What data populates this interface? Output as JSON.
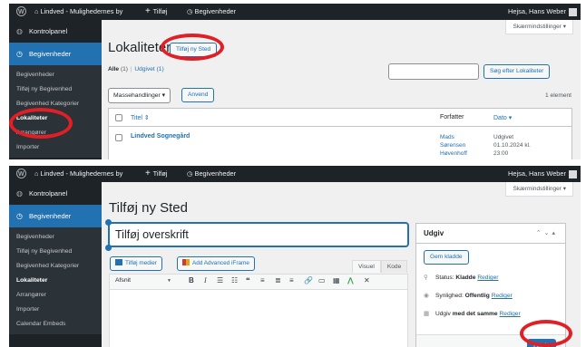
{
  "colors": {
    "admin_bar": "#1d2327",
    "accent": "#2271b1",
    "highlight_ring": "#e01f26"
  },
  "top": {
    "adminbar": {
      "site_name": "Lindved - Mulighedernes by",
      "new_label": "Tilføj",
      "events_label": "Begivenheder",
      "greeting": "Hejsa, Hans Weber"
    },
    "sidebar": {
      "dashboard": "Kontrolpanel",
      "events": "Begivenheder",
      "items": [
        "Begivenheder",
        "Tilføj ny Begivenhed",
        "Begivenhed Kategorier",
        "Lokaliteter",
        "Arrangører",
        "Importer"
      ]
    },
    "screen_options": "Skærmindstillinger",
    "title": "Lokaliteter",
    "add_button": "Tilføj ny Sted",
    "filters": {
      "all_label": "Alle",
      "all_count": "(1)",
      "sep": "|",
      "published_label": "Udgivet",
      "published_count": "(1)"
    },
    "search_button": "Søg efter Lokaliteter",
    "bulk_select": "Massehandlinger",
    "apply_button": "Anvend",
    "item_count": "1 element",
    "columns": {
      "title": "Titel",
      "author": "Forfatter",
      "date": "Dato"
    },
    "rows": [
      {
        "title": "Lindved Sognegård",
        "author_lines": [
          "Mads",
          "Sørensen",
          "Høvenhoff"
        ],
        "date_lines": [
          "Udgivet",
          "01.10.2024 kl.",
          "23:00"
        ]
      }
    ]
  },
  "bottom": {
    "adminbar": {
      "site_name": "Lindved - Mulighedernes by",
      "new_label": "Tilføj",
      "events_label": "Begivenheder",
      "greeting": "Hejsa, Hans Weber"
    },
    "sidebar": {
      "dashboard": "Kontrolpanel",
      "events": "Begivenheder",
      "items": [
        "Begivenheder",
        "Tilføj ny Begivenhed",
        "Begivenhed Kategorier",
        "Lokaliteter",
        "Arrangører",
        "Importer",
        "Calendar Embeds"
      ]
    },
    "screen_options": "Skærmindstillinger",
    "title": "Tilføj ny Sted",
    "title_placeholder": "Tilføj overskrift",
    "add_media": "Tilføj medier",
    "add_iframe": "Add Advanced iFrame",
    "tabs": {
      "visual": "Visuel",
      "code": "Kode"
    },
    "format_select": "Afsnit",
    "publish_box": {
      "heading": "Udgiv",
      "save_draft": "Gem kladde",
      "status_label": "Status:",
      "status_value": "Kladde",
      "visibility_label": "Synlighed:",
      "visibility_value": "Offentlig",
      "publish_label": "Udgiv",
      "publish_value": "med det samme",
      "edit_link": "Rediger",
      "publish_button": "Udgiv"
    }
  }
}
